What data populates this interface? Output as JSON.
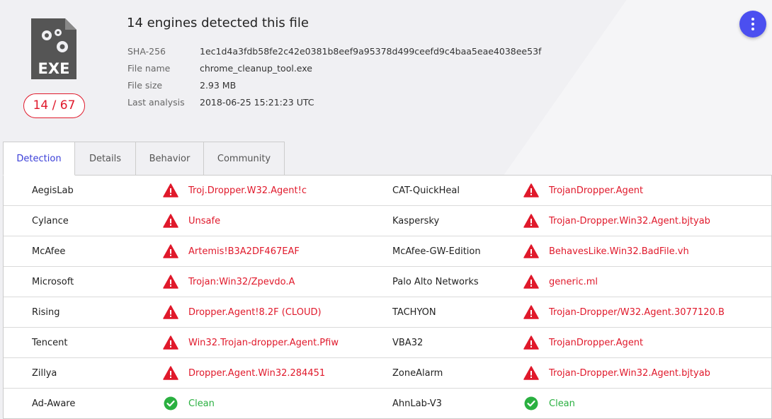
{
  "header": {
    "title": "14 engines detected this file",
    "score": "14 / 67",
    "file_type": "EXE",
    "meta": [
      {
        "label": "SHA-256",
        "value": "1ec1d4a3fdb58fe2c42e0381b8eef9a95378d499ceefd9c4baa5eae4038ee53f"
      },
      {
        "label": "File name",
        "value": "chrome_cleanup_tool.exe"
      },
      {
        "label": "File size",
        "value": "2.93 MB"
      },
      {
        "label": "Last analysis",
        "value": "2018-06-25 15:21:23 UTC"
      }
    ],
    "accent_color": "#4b4ff0",
    "malicious_color": "#e0192b",
    "clean_color": "#2ab040"
  },
  "tabs": [
    {
      "label": "Detection",
      "active": true
    },
    {
      "label": "Details",
      "active": false
    },
    {
      "label": "Behavior",
      "active": false
    },
    {
      "label": "Community",
      "active": false
    }
  ],
  "detections": [
    {
      "left": {
        "engine": "AegisLab",
        "result": "Troj.Dropper.W32.Agent!c",
        "status": "malicious"
      },
      "right": {
        "engine": "CAT-QuickHeal",
        "result": "TrojanDropper.Agent",
        "status": "malicious"
      }
    },
    {
      "left": {
        "engine": "Cylance",
        "result": "Unsafe",
        "status": "malicious"
      },
      "right": {
        "engine": "Kaspersky",
        "result": "Trojan-Dropper.Win32.Agent.bjtyab",
        "status": "malicious"
      }
    },
    {
      "left": {
        "engine": "McAfee",
        "result": "Artemis!B3A2DF467EAF",
        "status": "malicious"
      },
      "right": {
        "engine": "McAfee-GW-Edition",
        "result": "BehavesLike.Win32.BadFile.vh",
        "status": "malicious"
      }
    },
    {
      "left": {
        "engine": "Microsoft",
        "result": "Trojan:Win32/Zpevdo.A",
        "status": "malicious"
      },
      "right": {
        "engine": "Palo Alto Networks",
        "result": "generic.ml",
        "status": "malicious"
      }
    },
    {
      "left": {
        "engine": "Rising",
        "result": "Dropper.Agent!8.2F (CLOUD)",
        "status": "malicious"
      },
      "right": {
        "engine": "TACHYON",
        "result": "Trojan-Dropper/W32.Agent.3077120.B",
        "status": "malicious"
      }
    },
    {
      "left": {
        "engine": "Tencent",
        "result": "Win32.Trojan-dropper.Agent.Pfiw",
        "status": "malicious"
      },
      "right": {
        "engine": "VBA32",
        "result": "TrojanDropper.Agent",
        "status": "malicious"
      }
    },
    {
      "left": {
        "engine": "Zillya",
        "result": "Dropper.Agent.Win32.284451",
        "status": "malicious"
      },
      "right": {
        "engine": "ZoneAlarm",
        "result": "Trojan-Dropper.Win32.Agent.bjtyab",
        "status": "malicious"
      }
    },
    {
      "left": {
        "engine": "Ad-Aware",
        "result": "Clean",
        "status": "clean"
      },
      "right": {
        "engine": "AhnLab-V3",
        "result": "Clean",
        "status": "clean"
      }
    }
  ]
}
